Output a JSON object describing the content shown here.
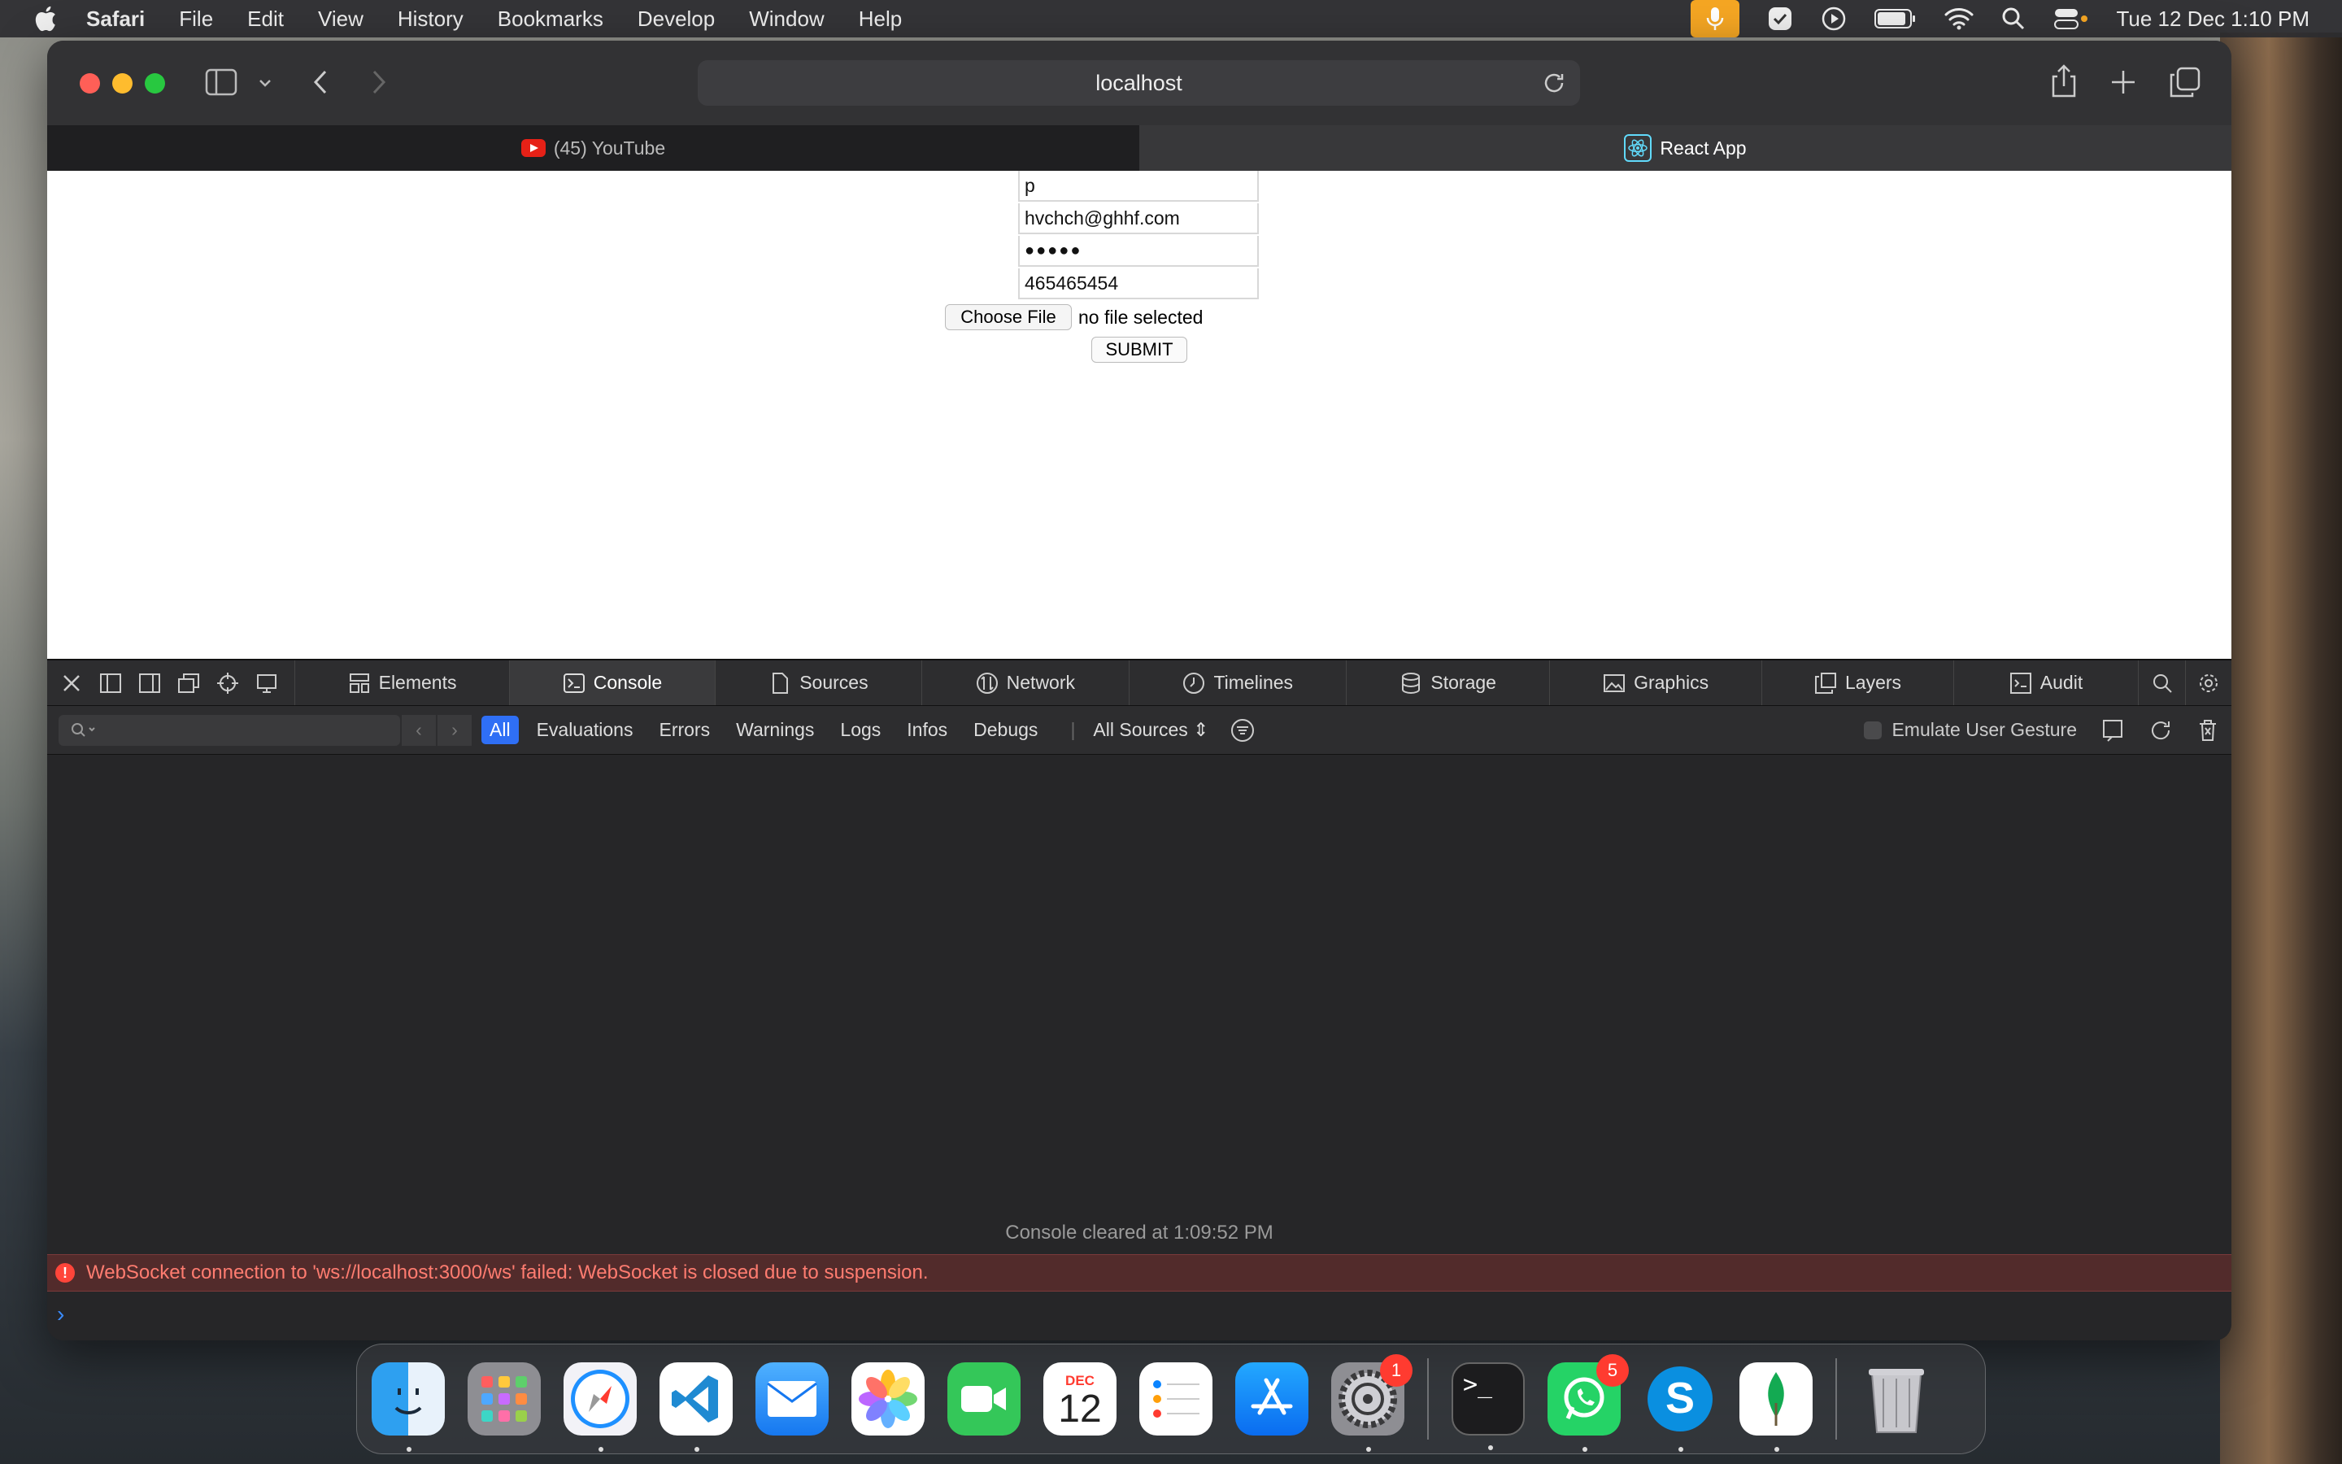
{
  "menubar": {
    "app_name": "Safari",
    "items": [
      "File",
      "Edit",
      "View",
      "History",
      "Bookmarks",
      "Develop",
      "Window",
      "Help"
    ],
    "clock": "Tue 12 Dec  1:10 PM"
  },
  "browser": {
    "url": "localhost",
    "tabs": [
      {
        "label": "(45) YouTube",
        "icon": "youtube-icon"
      },
      {
        "label": "React App",
        "icon": "react-icon"
      }
    ]
  },
  "form": {
    "name_value": "p",
    "email_value": "hvchch@ghhf.com",
    "password_value": "●●●●●",
    "phone_value": "465465454",
    "choose_file_label": "Choose File",
    "file_status": "no file selected",
    "submit_label": "SUBMIT"
  },
  "devtools": {
    "tabs": [
      "Elements",
      "Console",
      "Sources",
      "Network",
      "Timelines",
      "Storage",
      "Graphics",
      "Layers",
      "Audit"
    ],
    "active_tab": "Console",
    "filters": [
      "All",
      "Evaluations",
      "Errors",
      "Warnings",
      "Logs",
      "Infos",
      "Debugs"
    ],
    "sources_select": "All Sources",
    "emulate_label": "Emulate User Gesture",
    "cleared_message": "Console cleared at 1:09:52 PM",
    "error_message": "WebSocket connection to 'ws://localhost:3000/ws' failed: WebSocket is closed due to suspension.",
    "prompt_symbol": "›"
  },
  "dock": {
    "calendar_month": "DEC",
    "calendar_day": "12",
    "settings_badge": "1",
    "whatsapp_badge": "5"
  },
  "colors": {
    "accent": "#2f6ff5",
    "error_text": "#ff7c70",
    "mic_active": "#f5a623"
  }
}
